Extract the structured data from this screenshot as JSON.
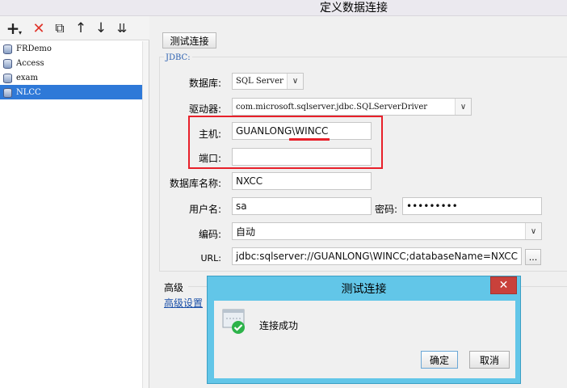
{
  "window": {
    "title": "定义数据连接"
  },
  "toolbar": {
    "icons": [
      "plus-icon",
      "dropdown-caret-icon",
      "delete-icon",
      "copy-icon",
      "arrow-up-icon",
      "arrow-down-icon",
      "sort-icon"
    ],
    "glyphs": {
      "add": "+",
      "caret": "▾",
      "delete": "✕",
      "copy": "⧉",
      "up": "↑",
      "down": "↓",
      "sort": "⇊"
    }
  },
  "connections": [
    {
      "label": "FRDemo",
      "selected": false
    },
    {
      "label": "Access",
      "selected": false
    },
    {
      "label": "exam",
      "selected": false
    },
    {
      "label": "NLCC",
      "selected": true
    }
  ],
  "form": {
    "test_button": "测试连接",
    "jdbc_legend": "JDBC:",
    "db_label": "数据库:",
    "db_value": "SQL Server",
    "driver_label": "驱动器:",
    "driver_value": "com.microsoft.sqlserver.jdbc.SQLServerDriver",
    "host_label": "主机:",
    "host_value": "GUANLONG\\WINCC",
    "port_label": "端口:",
    "port_value": "",
    "dbname_label": "数据库名称:",
    "dbname_value": "NXCC",
    "user_label": "用户名:",
    "user_value": "sa",
    "password_label": "密码:",
    "password_value": "•••••••••",
    "encoding_label": "编码:",
    "encoding_value": "自动",
    "url_label": "URL:",
    "url_value": "jdbc:sqlserver://GUANLONG\\WINCC;databaseName=NXCC",
    "url_button": "...",
    "combo_arrow": "∨"
  },
  "advanced": {
    "label": "高级",
    "link": "高级设置"
  },
  "dialog": {
    "title": "测试连接",
    "close": "✕",
    "message": "连接成功",
    "ok": "确定",
    "cancel": "取消"
  },
  "colors": {
    "selection": "#2e79d8",
    "highlight": "#e8202a",
    "dialog_frame": "#62c6e8",
    "close_button": "#c9413b",
    "link": "#1a4fa8",
    "success": "#2db34a"
  }
}
